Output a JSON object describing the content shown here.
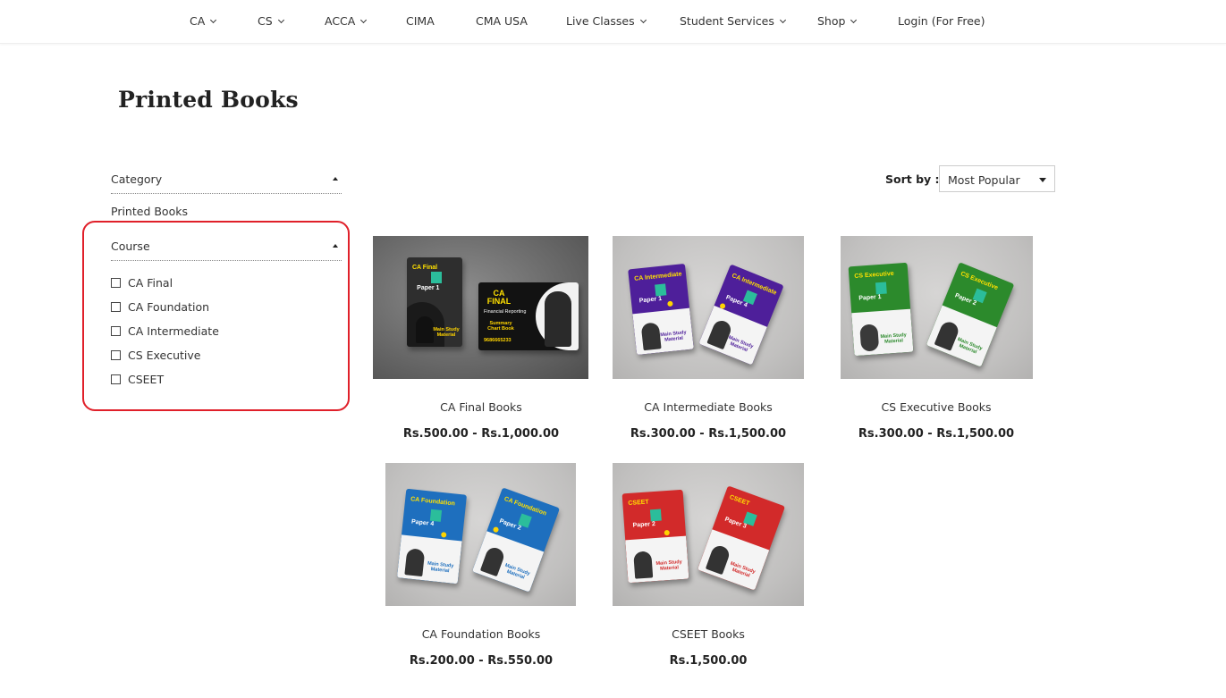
{
  "nav": {
    "items": [
      {
        "label": "CA",
        "dropdown": true
      },
      {
        "label": "CS",
        "dropdown": true
      },
      {
        "label": "ACCA",
        "dropdown": true
      },
      {
        "label": "CIMA",
        "dropdown": false
      },
      {
        "label": "CMA USA",
        "dropdown": false
      },
      {
        "label": "Live Classes",
        "dropdown": true
      },
      {
        "label": "Student Services",
        "dropdown": true
      },
      {
        "label": "Shop",
        "dropdown": true
      },
      {
        "label": "Login (For Free)",
        "dropdown": false
      }
    ]
  },
  "page": {
    "title": "Printed Books"
  },
  "sidebar": {
    "category": {
      "heading": "Category",
      "items": [
        "Printed Books"
      ]
    },
    "course": {
      "heading": "Course",
      "options": [
        "CA Final",
        "CA Foundation",
        "CA Intermediate",
        "CS Executive",
        "CSEET"
      ]
    }
  },
  "sort": {
    "label": "Sort by :",
    "selected": "Most Popular"
  },
  "products": [
    {
      "name": "CA Final Books",
      "price": "Rs.500.00 - Rs.1,000.00",
      "cover_color": "#3a3a3a"
    },
    {
      "name": "CA Intermediate Books",
      "price": "Rs.300.00 - Rs.1,500.00",
      "cover_color": "#5b2a9e"
    },
    {
      "name": "CS Executive Books",
      "price": "Rs.300.00 - Rs.1,500.00",
      "cover_color": "#2e8b2e"
    },
    {
      "name": "CA Foundation Books",
      "price": "Rs.200.00 - Rs.550.00",
      "cover_color": "#1f6fbf"
    },
    {
      "name": "CSEET Books",
      "price": "Rs.1,500.00",
      "cover_color": "#d42b2b"
    }
  ],
  "covers": {
    "ca_final": {
      "left_title": "CA Final",
      "left_paper": "Paper 1",
      "right_title": "CA FINAL",
      "right_sub": "Financial Reporting",
      "right_summary": "Summary Chart Book",
      "right_phone": "9686665233"
    },
    "ca_inter": {
      "left_title": "CA Intermediate",
      "left_paper": "Paper 1",
      "right_title": "CA Intermediate",
      "right_paper": "Paper 4"
    },
    "cs_exec": {
      "left_title": "CS Executive",
      "left_paper": "Paper 1",
      "right_title": "CS Executive",
      "right_paper": "Paper 2"
    },
    "ca_found": {
      "left_title": "CA Foundation",
      "left_paper": "Paper 4",
      "right_title": "CA Foundation",
      "right_paper": "Paper 2"
    },
    "cseet": {
      "left_title": "CSEET",
      "left_paper": "Paper 2",
      "right_title": "CSEET",
      "right_paper": "Paper 3"
    },
    "main_study": "Main Study Material"
  },
  "colors": {
    "highlight_border": "#e0202a",
    "text": "#222222",
    "image_bg": "#c9c8c7",
    "image_bg_dark": "#7a7a7a"
  }
}
